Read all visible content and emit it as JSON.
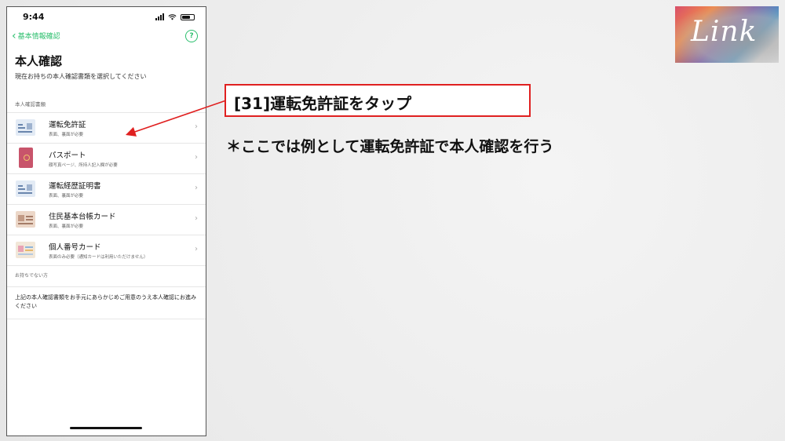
{
  "phone": {
    "status_time": "9:44",
    "nav": {
      "back_label": "基本情報確認",
      "help_icon": "?"
    },
    "title": "本人確認",
    "subtitle": "現在お持ちの本人確認書類を選択してください",
    "section_label": "本人確認書類",
    "documents": [
      {
        "name": "運転免許証",
        "note": "表面、裏面が必要",
        "icon": "drivers-license-icon"
      },
      {
        "name": "パスポート",
        "note": "顔写真ページ、所持人記入欄が必要",
        "icon": "passport-icon"
      },
      {
        "name": "運転経歴証明書",
        "note": "表面、裏面が必要",
        "icon": "driving-record-icon"
      },
      {
        "name": "住民基本台帳カード",
        "note": "表面、裏面が必要",
        "icon": "resident-card-icon"
      },
      {
        "name": "個人番号カード",
        "note": "表面のみ必要（通知カードは利用いただけません）",
        "icon": "my-number-card-icon"
      }
    ],
    "no_doc_label": "お持ちでない方",
    "no_doc_text": "上記の本人確認書類をお手元にあらかじめご用意のうえ本人確認にお進みください"
  },
  "callout": {
    "instruction": "[31]運転免許証をタップ",
    "note": "＊ここでは例として運転免許証で本人確認を行う"
  },
  "logo": {
    "text": "Link"
  },
  "colors": {
    "accent_green": "#2bbf6d",
    "callout_red": "#e02020"
  }
}
